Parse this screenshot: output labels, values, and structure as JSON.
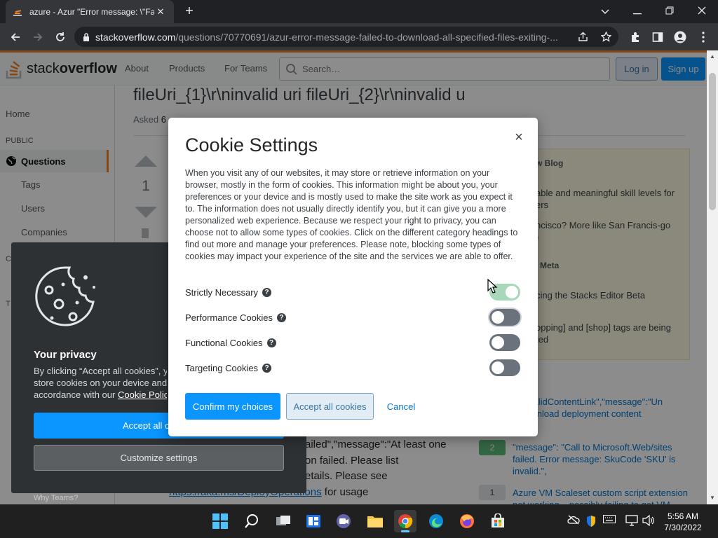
{
  "browser": {
    "tab_title": "azure - Azur \"Error message: \\\"Fa",
    "url_host": "stackoverflow.com",
    "url_path": "/questions/70770691/azur-error-message-failed-to-download-all-specified-files-exiting-...",
    "new_tab_label": "+",
    "close_tab_label": "✕"
  },
  "so_header": {
    "logo_prefix": "stack",
    "logo_suffix": "overflow",
    "nav": [
      "About",
      "Products",
      "For Teams"
    ],
    "search_placeholder": "Search…",
    "login_label": "Log in",
    "signup_label": "Sign up"
  },
  "left_nav": {
    "home": "Home",
    "public": "PUBLIC",
    "questions": "Questions",
    "tags": "Tags",
    "users": "Users",
    "companies": "Companies",
    "collectives_initial": "C",
    "teams_initial": "T",
    "why_teams": "Why Teams?"
  },
  "question": {
    "title": "fileUri_{1}\\r\\ninvalid uri fileUri_{2}\\r\\ninvalid u",
    "asked_label": "Asked",
    "asked_value": "6",
    "vote_count": "1",
    "body_lines": [
      "ailed\",\"message\":\"At least one",
      "on failed. Please list",
      "etails. Please see"
    ],
    "link_text": "https://aka.ms/DeployOperations",
    "link_suffix": " for usage"
  },
  "sidebar": {
    "blog_heading": "w Blog",
    "blog_items": [
      "able and meaningful skill levels for\ners",
      "ncisco? More like San Francis-go\n)"
    ],
    "meta_heading": "Meta",
    "meta_items": [
      "cing the Stacks Editor Beta",
      "opping] and [shop] tags are being\nted"
    ],
    "related": [
      {
        "score": "",
        "text": "\":\"invalidContentLink\",\"message\":\"Un\no download deployment content"
      },
      {
        "score": "2",
        "text": "\"message\": \"Call to Microsoft.Web/sites\nfailed. Error message: SkuCode 'SKU' is\ninvalid.\","
      },
      {
        "score": "1",
        "text": "Azure VM Scaleset custom script extension\nnot working – possibly failing to get VM"
      }
    ]
  },
  "privacy": {
    "title": "Your privacy",
    "text_line1": "By clicking “Accept all cookies”, you",
    "text_line2": "store cookies on your device and",
    "text_line3": "accordance with our",
    "link": "Cookie Policy",
    "accept_all_label": "Accept all cookies",
    "customize_label": "Customize settings"
  },
  "modal": {
    "title": "Cookie Settings",
    "close_label": "×",
    "body": "When you visit any of our websites, it may store or retrieve information on your browser, mostly in the form of cookies. This information might be about you, your preferences or your device and is mostly used to make the site work as you expect it to. The information does not usually directly identify you, but it can give you a more personalized web experience. Because we respect your right to privacy, you can choose not to allow some types of cookies. Click on the different category headings to find out more and manage your preferences. Please note, blocking some types of cookies may impact your experience of the site and the services we are able to offer.",
    "help_glyph": "?",
    "categories": [
      {
        "label": "Strictly Necessary",
        "enabled": true
      },
      {
        "label": "Performance Cookies",
        "enabled": false
      },
      {
        "label": "Functional Cookies",
        "enabled": false
      },
      {
        "label": "Targeting Cookies",
        "enabled": false
      }
    ],
    "confirm_label": "Confirm my choices",
    "accept_label": "Accept all cookies",
    "cancel_label": "Cancel"
  },
  "taskbar": {
    "time": "5:56 AM",
    "date": "7/30/2022",
    "apps": [
      "start-icon",
      "search-icon",
      "task-view-icon",
      "widgets-icon",
      "chat-icon",
      "file-explorer-icon",
      "chrome-icon",
      "edge-icon",
      "firefox-icon",
      "store-icon"
    ]
  },
  "colors": {
    "so_orange": "#f48225",
    "so_blue": "#0a95ff",
    "link_blue": "#0074cc",
    "toggle_on": "#a8d8b9",
    "toggle_off": "#6a737c"
  }
}
